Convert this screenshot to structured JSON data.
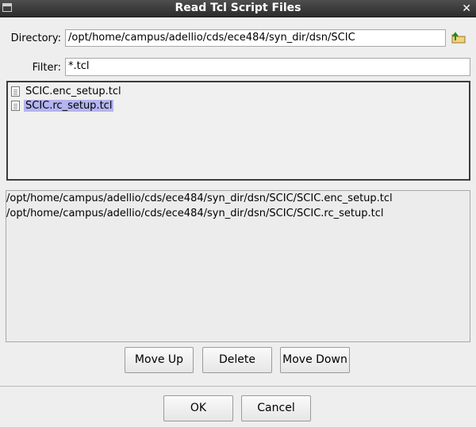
{
  "window": {
    "title": "Read Tcl Script Files"
  },
  "directory": {
    "label": "Directory:",
    "value": "/opt/home/campus/adellio/cds/ece484/syn_dir/dsn/SCIC"
  },
  "filter": {
    "label": "Filter:",
    "value": "*.tcl"
  },
  "files": [
    {
      "name": "SCIC.enc_setup.tcl",
      "selected": false
    },
    {
      "name": "SCIC.rc_setup.tcl",
      "selected": true
    }
  ],
  "selected_paths": [
    "/opt/home/campus/adellio/cds/ece484/syn_dir/dsn/SCIC/SCIC.enc_setup.tcl",
    "/opt/home/campus/adellio/cds/ece484/syn_dir/dsn/SCIC/SCIC.rc_setup.tcl"
  ],
  "buttons": {
    "move_up": "Move Up",
    "delete": "Delete",
    "move_down": "Move Down",
    "ok": "OK",
    "cancel": "Cancel"
  },
  "colors": {
    "selection": "#b4b4f0",
    "titlebar": "#3a3a3a"
  }
}
